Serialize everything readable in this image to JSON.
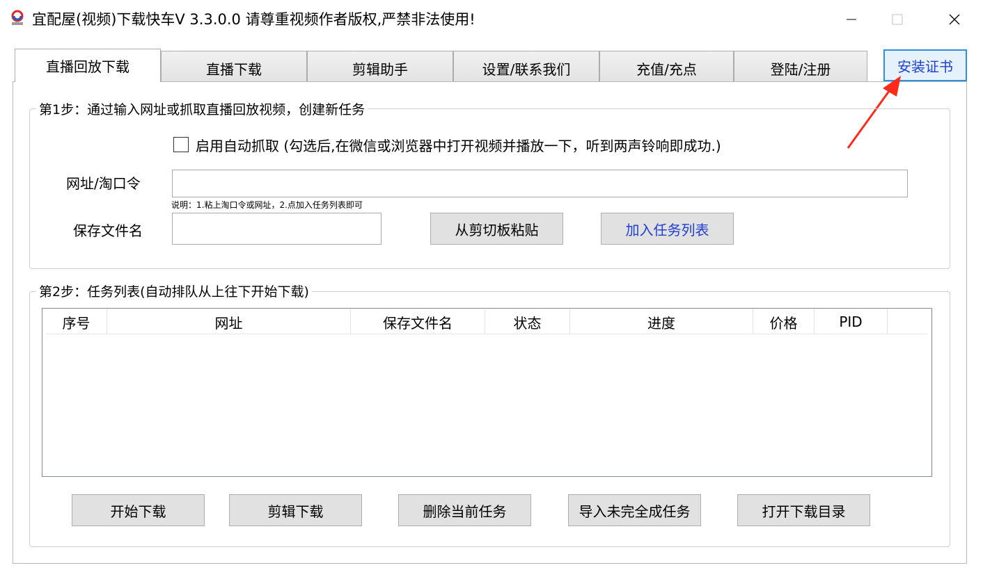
{
  "window": {
    "title": "宜配屋(视频)下载快车V 3.3.0.0 请尊重视频作者版权,严禁非法使用!",
    "app_icon": "app-logo-icon",
    "controls": {
      "minimize": "—",
      "maximize": "☐",
      "close": "✕"
    }
  },
  "tabs": [
    {
      "label": "直播回放下载",
      "active": true
    },
    {
      "label": "直播下载"
    },
    {
      "label": "剪辑助手"
    },
    {
      "label": "设置/联系我们"
    },
    {
      "label": "充值/充点"
    },
    {
      "label": "登陆/注册"
    }
  ],
  "install_button": {
    "label": "安装证书"
  },
  "step1": {
    "legend": "第1步：通过输入网址或抓取直播回放视频，创建新任务",
    "auto_capture": {
      "checked": false,
      "label": "启用自动抓取 (勾选后,在微信或浏览器中打开视频并播放一下，听到两声铃响即成功.)"
    },
    "url_label": "网址/淘口令",
    "url_value": "",
    "hint": "说明：1.粘上淘口令或网址，2.点加入任务列表即可",
    "filename_label": "保存文件名",
    "filename_value": "",
    "paste_button": "从剪切板粘贴",
    "add_button": "加入任务列表"
  },
  "step2": {
    "legend": "第2步：任务列表(自动排队从上往下开始下载)",
    "columns": [
      "序号",
      "网址",
      "保存文件名",
      "状态",
      "进度",
      "价格",
      "PID"
    ],
    "rows": [],
    "buttons": [
      "开始下载",
      "剪辑下载",
      "删除当前任务",
      "导入未完全成任务",
      "打开下载目录"
    ]
  },
  "colors": {
    "accent_blue": "#1f3fd0",
    "annotation_red": "#ff2a1a",
    "panel_border": "#b9b9b9"
  }
}
